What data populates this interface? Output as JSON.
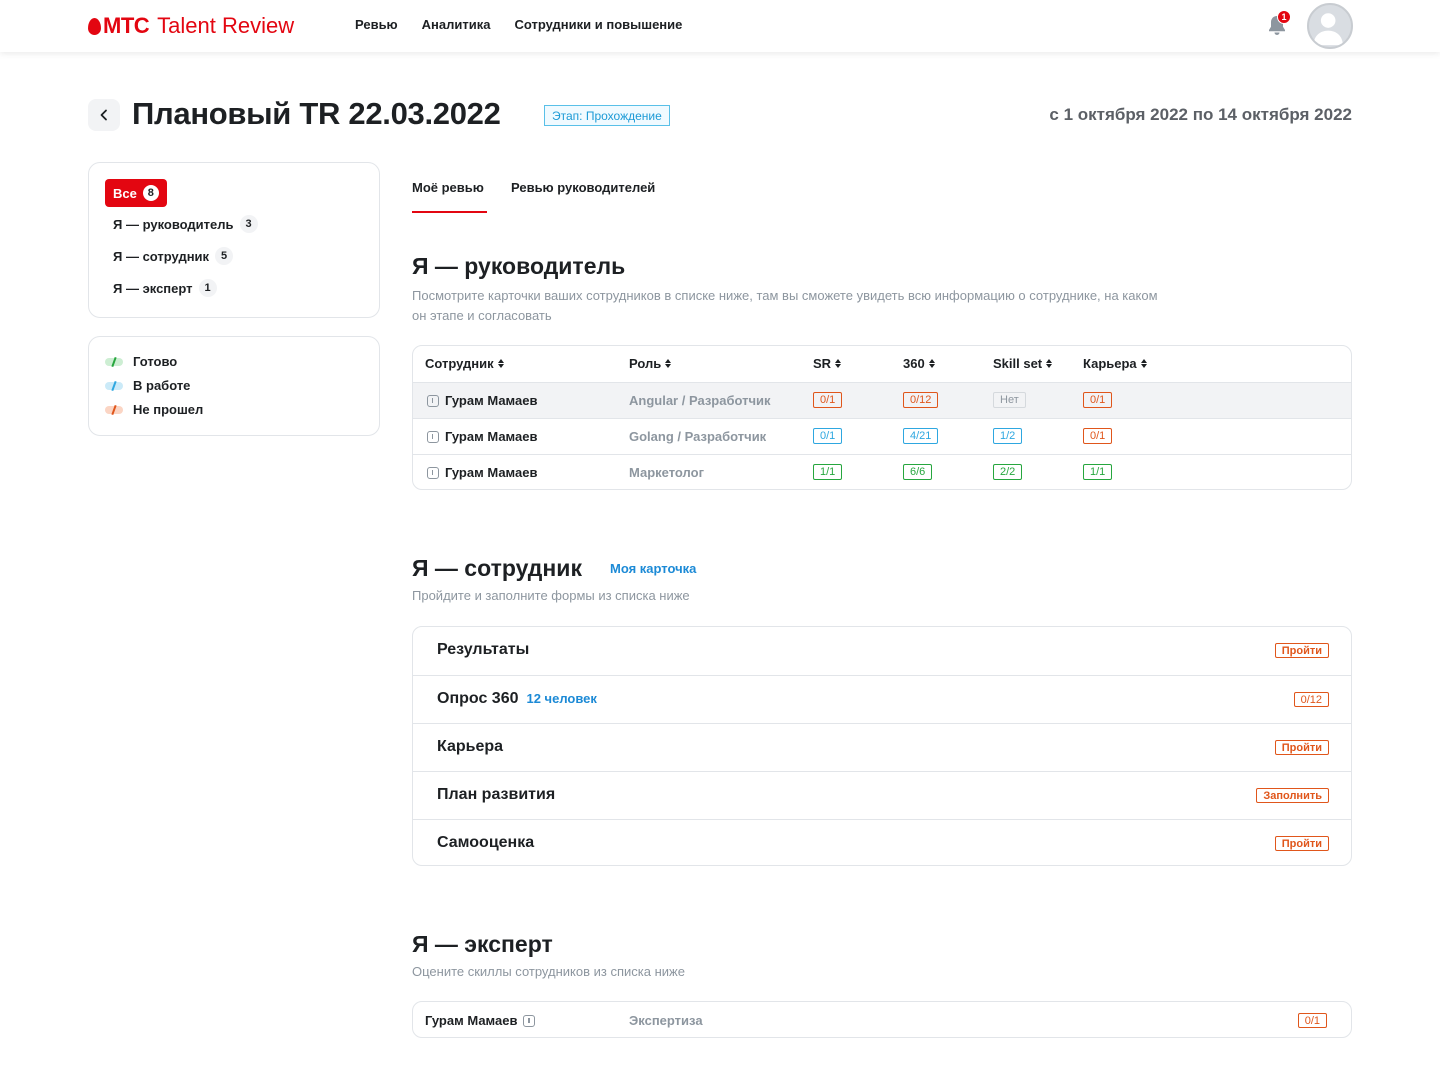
{
  "header": {
    "brand": "МТС",
    "product": "Talent Review",
    "nav": [
      "Ревью",
      "Аналитика",
      "Сотрудники и повышение"
    ],
    "notifications_count": "1"
  },
  "page": {
    "title": "Плановый TR 22.03.2022",
    "stage": "Этап: Прохождение",
    "dates": "с 1 октября 2022 по 14 октября 2022"
  },
  "filters": {
    "all": {
      "label": "Все",
      "count": "8"
    },
    "items": [
      {
        "label": "Я — руководитель",
        "count": "3"
      },
      {
        "label": "Я — сотрудник",
        "count": "5"
      },
      {
        "label": "Я — эксперт",
        "count": "1"
      }
    ]
  },
  "legend": [
    {
      "label": "Готово",
      "color": "#26a63e"
    },
    {
      "label": "В работе",
      "color": "#2ea7e0"
    },
    {
      "label": "Не прошел",
      "color": "#e0561b"
    }
  ],
  "tabs": [
    "Моё ревью",
    "Ревью руководителей"
  ],
  "manager": {
    "title": "Я — руководитель",
    "description": "Посмотрите карточки ваших сотрудников в списке ниже, там вы сможете увидеть всю информацию о сотруднике, на каком он этапе и согласовать",
    "columns": [
      "Сотрудник",
      "Роль",
      "SR",
      "360",
      "Skill set",
      "Карьера"
    ],
    "rows": [
      {
        "name": "Гурам Мамаев",
        "role": "Angular / Разработчик",
        "sr": "0/1",
        "p360": "0/12",
        "skills": "Нет",
        "career": "0/1"
      },
      {
        "name": "Гурам Мамаев",
        "role": "Golang / Разработчик",
        "sr": "0/1",
        "p360": "4/21",
        "skills": "1/2",
        "career": "0/1"
      },
      {
        "name": "Гурам Мамаев",
        "role": "Маркетолог",
        "sr": "1/1",
        "p360": "6/6",
        "skills": "2/2",
        "career": "1/1"
      }
    ]
  },
  "employee": {
    "title": "Я — сотрудник",
    "my_card": "Моя карточка",
    "description": "Пройдите и заполните формы из списка ниже",
    "forms": [
      {
        "title": "Результаты",
        "sub": "",
        "action": "Пройти"
      },
      {
        "title": "Опрос 360",
        "sub": "12 человек",
        "action": "0/12"
      },
      {
        "title": "Карьера",
        "sub": "",
        "action": "Пройти"
      },
      {
        "title": "План развития",
        "sub": "",
        "action": "Заполнить"
      },
      {
        "title": "Самооценка",
        "sub": "",
        "action": "Пройти"
      }
    ]
  },
  "expert": {
    "title": "Я — эксперт",
    "description": "Оцените скиллы сотрудников из списка ниже",
    "row": {
      "name": "Гурам Мамаев",
      "role": "Экспертиза",
      "status": "0/1"
    }
  }
}
